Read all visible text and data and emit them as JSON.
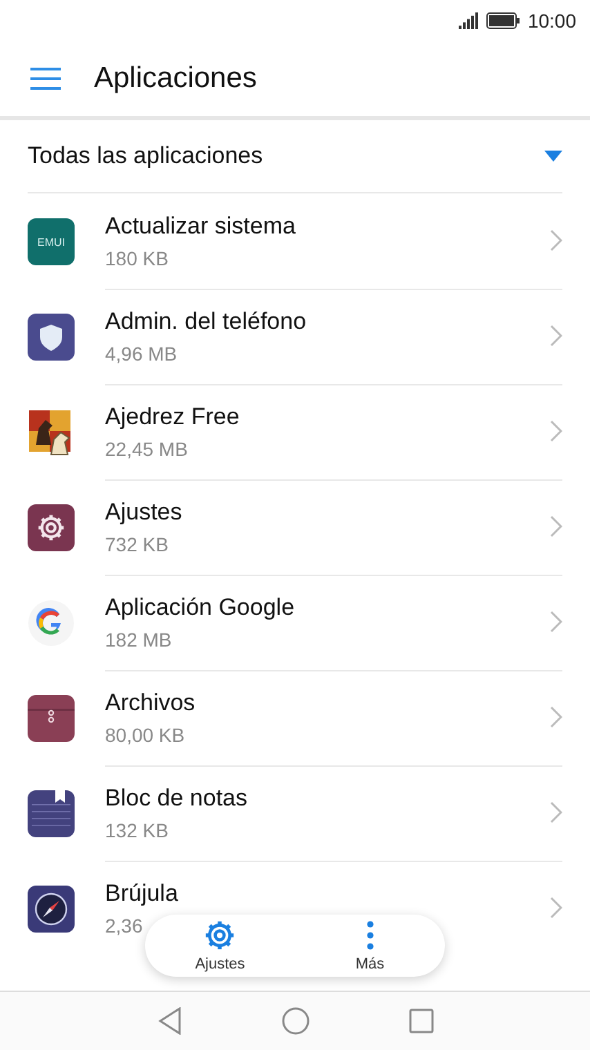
{
  "status_bar": {
    "time": "10:00"
  },
  "app_bar": {
    "title": "Aplicaciones"
  },
  "filter": {
    "label": "Todas las aplicaciones"
  },
  "apps": [
    {
      "name": "Actualizar sistema",
      "size": "180 KB",
      "icon_text": "EMUI"
    },
    {
      "name": "Admin. del teléfono",
      "size": "4,96 MB"
    },
    {
      "name": "Ajedrez Free",
      "size": "22,45 MB"
    },
    {
      "name": "Ajustes",
      "size": "732 KB"
    },
    {
      "name": "Aplicación Google",
      "size": "182 MB"
    },
    {
      "name": "Archivos",
      "size": "80,00 KB"
    },
    {
      "name": "Bloc de notas",
      "size": "132 KB"
    },
    {
      "name": "Brújula",
      "size": "2,36"
    }
  ],
  "floating_bar": [
    {
      "label": "Ajustes"
    },
    {
      "label": "Más"
    }
  ]
}
